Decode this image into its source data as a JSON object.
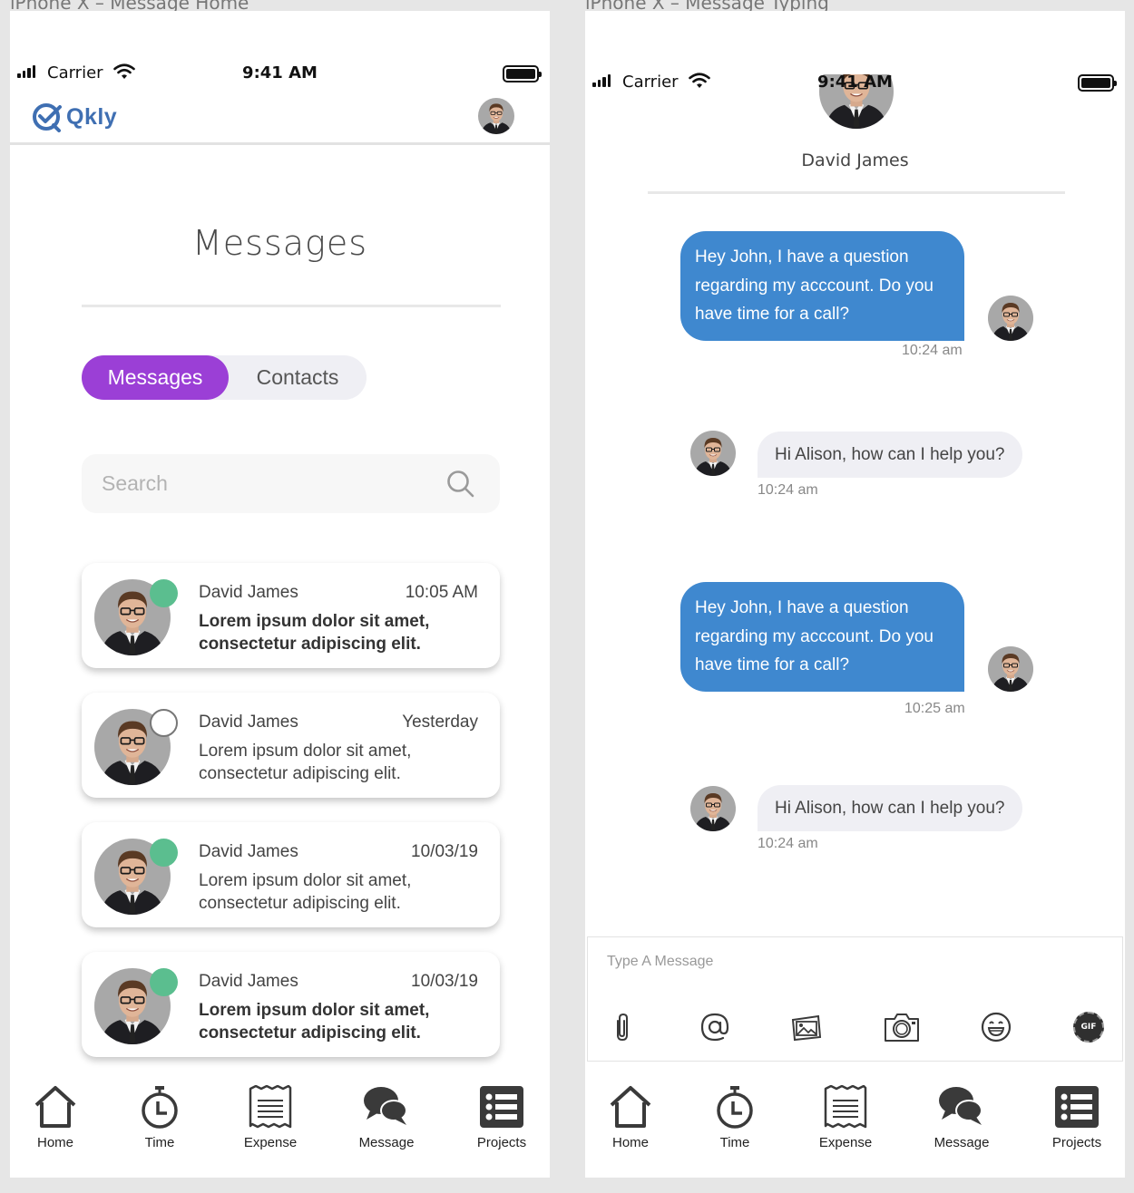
{
  "artboards": {
    "left_label": "iPhone X – Message Home",
    "right_label": "iPhone X – Message Typing"
  },
  "status_bar": {
    "carrier": "Carrier",
    "time": "9:41 AM"
  },
  "screen1": {
    "logo_text": "Qkly",
    "title": "Messages",
    "tabs": {
      "active": "Messages",
      "inactive": "Contacts"
    },
    "search_placeholder": "Search",
    "colors": {
      "accent_purple": "#9b3fd6",
      "online": "#5bbe8f",
      "brand_blue": "#3f6fb2"
    },
    "conversations": [
      {
        "name": "David James",
        "time": "10:05 AM",
        "message": "Lorem ipsum dolor sit amet, consectetur adipiscing elit.",
        "unread": true,
        "online": true
      },
      {
        "name": "David James",
        "time": "Yesterday",
        "message": "Lorem ipsum dolor sit amet, consectetur adipiscing elit.",
        "unread": false,
        "online": false
      },
      {
        "name": "David James",
        "time": "10/03/19",
        "message": "Lorem ipsum dolor sit amet, consectetur adipiscing elit.",
        "unread": false,
        "online": true
      },
      {
        "name": "David James",
        "time": "10/03/19",
        "message": "Lorem ipsum dolor sit amet, consectetur adipiscing elit.",
        "unread": true,
        "online": true
      }
    ]
  },
  "screen2": {
    "contact_name": "David James",
    "messages": [
      {
        "direction": "out",
        "text": "Hey John, I have a question regarding my acccount. Do you have time for a call?",
        "time": "10:24 am"
      },
      {
        "direction": "in",
        "text": "Hi Alison, how can I help you?",
        "time": "10:24 am"
      },
      {
        "direction": "out",
        "text": "Hey John, I have a question regarding my acccount. Do you have time for a call?",
        "time": "10:25 am"
      },
      {
        "direction": "in",
        "text": "Hi Alison, how can I help you?",
        "time": "10:24 am"
      }
    ],
    "composer_placeholder": "Type A Message",
    "composer_tools": [
      "paperclip-icon",
      "at-sign-icon",
      "image-icon",
      "camera-icon",
      "emoji-icon",
      "gif-icon"
    ],
    "gif_label": "GIF",
    "colors": {
      "outgoing_bubble": "#3f88cf",
      "incoming_bubble": "#efeff4"
    }
  },
  "nav": {
    "items": [
      {
        "label": "Home",
        "icon": "home-icon"
      },
      {
        "label": "Time",
        "icon": "stopwatch-icon"
      },
      {
        "label": "Expense",
        "icon": "receipt-icon"
      },
      {
        "label": "Message",
        "icon": "chat-bubbles-icon"
      },
      {
        "label": "Projects",
        "icon": "list-icon"
      }
    ]
  }
}
